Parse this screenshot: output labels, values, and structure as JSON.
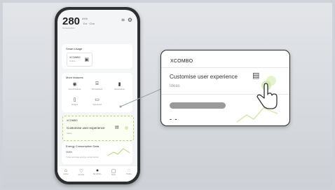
{
  "phone": {
    "status": {
      "big_number": "280",
      "sup_text": "kWh",
      "sub_text": "Ea · Cha",
      "foot_text": "Consumption"
    },
    "smart_usage": {
      "title": "Smart Usage",
      "device_name": "XCOMBO",
      "device_sub": "Online"
    },
    "features": {
      "title": "More features",
      "items": [
        {
          "label": "Cool Pressure",
          "icon": "target-icon"
        },
        {
          "label": "Oil Assistant",
          "icon": "bag-icon"
        },
        {
          "label": "Accessories",
          "icon": "spray-bottle-icon"
        },
        {
          "label": "Fridges",
          "icon": "fridge-icon"
        },
        {
          "label": "Tips Hood",
          "icon": "microwave-icon"
        }
      ]
    },
    "xcombo_card": {
      "title": "XCOMBO",
      "main": "Customise user experience",
      "ideas": "Ideas"
    },
    "energy_card": {
      "title": "Energy Consumption Data",
      "value": "0kWh",
      "sub": "7-day average energy consumption"
    },
    "nav": [
      {
        "label": "Home",
        "icon": "home-icon",
        "active": false
      },
      {
        "label": "Service",
        "icon": "heart-icon",
        "active": false
      },
      {
        "label": "My Whirlp.",
        "icon": "user-icon",
        "active": true
      },
      {
        "label": "Store",
        "icon": "store-icon",
        "active": false
      },
      {
        "label": "Profile",
        "icon": "profile-icon",
        "active": false
      }
    ]
  },
  "popup": {
    "title": "XCOMBO",
    "main": "Customise user experience",
    "ideas": "Ideas",
    "dash": "- -"
  },
  "colors": {
    "accent_green": "#b8d67a",
    "popup_border": "#2c2c2c"
  }
}
